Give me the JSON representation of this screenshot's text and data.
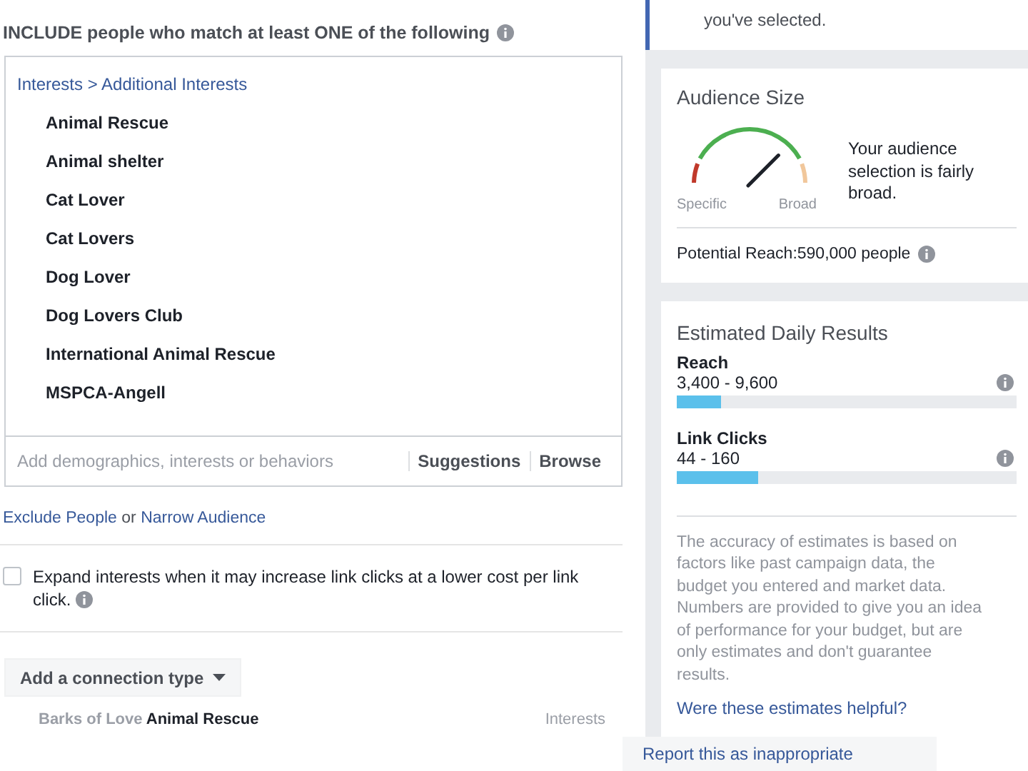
{
  "include": {
    "heading": "INCLUDE people who match at least ONE of the following",
    "breadcrumb": "Interests > Additional Interests",
    "items": [
      "Animal Rescue",
      "Animal shelter",
      "Cat Lover",
      "Cat Lovers",
      "Dog Lover",
      "Dog Lovers Club",
      "International Animal Rescue",
      "MSPCA-Angell"
    ],
    "search": {
      "placeholder": "Add demographics, interests or behaviors"
    },
    "actions": [
      "Suggestions",
      "Browse"
    ]
  },
  "narrow": {
    "link_1": "Exclude People",
    "joiner": "or",
    "link_2": "Narrow Audience"
  },
  "expand": {
    "checked": false,
    "label": "Expand interests when it may increase link clicks at a lower cost per link click."
  },
  "connection_button": "Add a connection type",
  "suggestion": {
    "name_faded": "Barks of Love",
    "name": "Animal Rescue",
    "category": "Interests"
  },
  "tip": {
    "text": "you've selected."
  },
  "audience_size": {
    "title": "Audience Size",
    "level": 0.75,
    "low_label": "Specific",
    "high_label": "Broad",
    "description": "Your audience selection is fairly broad.",
    "potential_reach": "Potential Reach:590,000 people"
  },
  "estimated": {
    "title": "Estimated Daily Results",
    "metrics": [
      {
        "name": "Reach",
        "range": "3,400 - 9,600",
        "level": 0.13
      },
      {
        "name": "Link Clicks",
        "range": "44 - 160",
        "level": 0.24
      }
    ],
    "note": "The accuracy of estimates is based on factors like past campaign data, the budget you entered and market data. Numbers are provided to give you an idea of performance for your budget, but are only estimates and don't guarantee results.",
    "feedback_link": "Were these estimates helpful?"
  },
  "report_link": "Report this as inappropriate"
}
